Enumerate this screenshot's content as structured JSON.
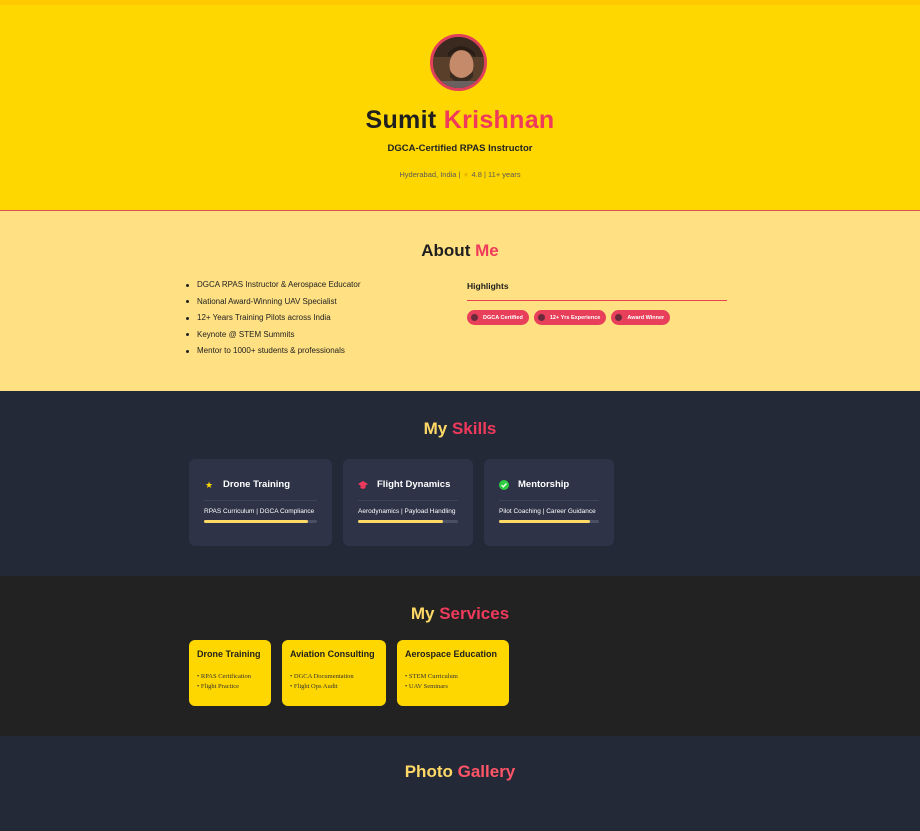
{
  "hero": {
    "first_name": "Sumit",
    "last_name": "Krishnan",
    "role": "DGCA-Certified RPAS Instructor",
    "location": "Hyderabad, India",
    "rating": "4.8",
    "experience": "11+ years"
  },
  "about": {
    "title_a": "About",
    "title_b": "Me",
    "items": [
      "DGCA RPAS Instructor & Aerospace Educator",
      "National Award-Winning UAV Specialist",
      "12+ Years Training Pilots across India",
      "Keynote @ STEM Summits",
      "Mentor to 1000+ students & professionals"
    ],
    "highlights_title": "Highlights",
    "badges": [
      "DGCA Certified",
      "12+ Yrs Experience",
      "Award Winner"
    ]
  },
  "skills": {
    "title_a": "My",
    "title_b": "Skills",
    "cards": [
      {
        "name": "Drone Training",
        "icon": "star-icon",
        "tags": "RPAS Curriculum | DGCA Compliance",
        "level": 0.92
      },
      {
        "name": "Flight Dynamics",
        "icon": "graduation-cap-icon",
        "tags": "Aerodynamics | Payload Handling",
        "level": 0.85
      },
      {
        "name": "Mentorship",
        "icon": "check-circle-icon",
        "tags": "Pilot Coaching | Career Guidance",
        "level": 0.91
      }
    ]
  },
  "services": {
    "title_a": "My",
    "title_b": "Services",
    "cards": [
      {
        "title": "Drone Training",
        "items": [
          "• RPAS Certification",
          "• Flight Practice"
        ]
      },
      {
        "title": "Aviation Consulting",
        "items": [
          "• DGCA Documentation",
          "• Flight Ops Audit"
        ]
      },
      {
        "title": "Aerospace Education",
        "items": [
          "• STEM Curriculum",
          "• UAV Seminars"
        ]
      }
    ]
  },
  "gallery": {
    "title_a": "Photo",
    "title_b": "Gallery"
  },
  "colors": {
    "hero_bg": "#FFD700",
    "about_bg": "#FFE082",
    "accent": "#F03A5C",
    "dark": "#242938",
    "card": "#2E3347"
  }
}
